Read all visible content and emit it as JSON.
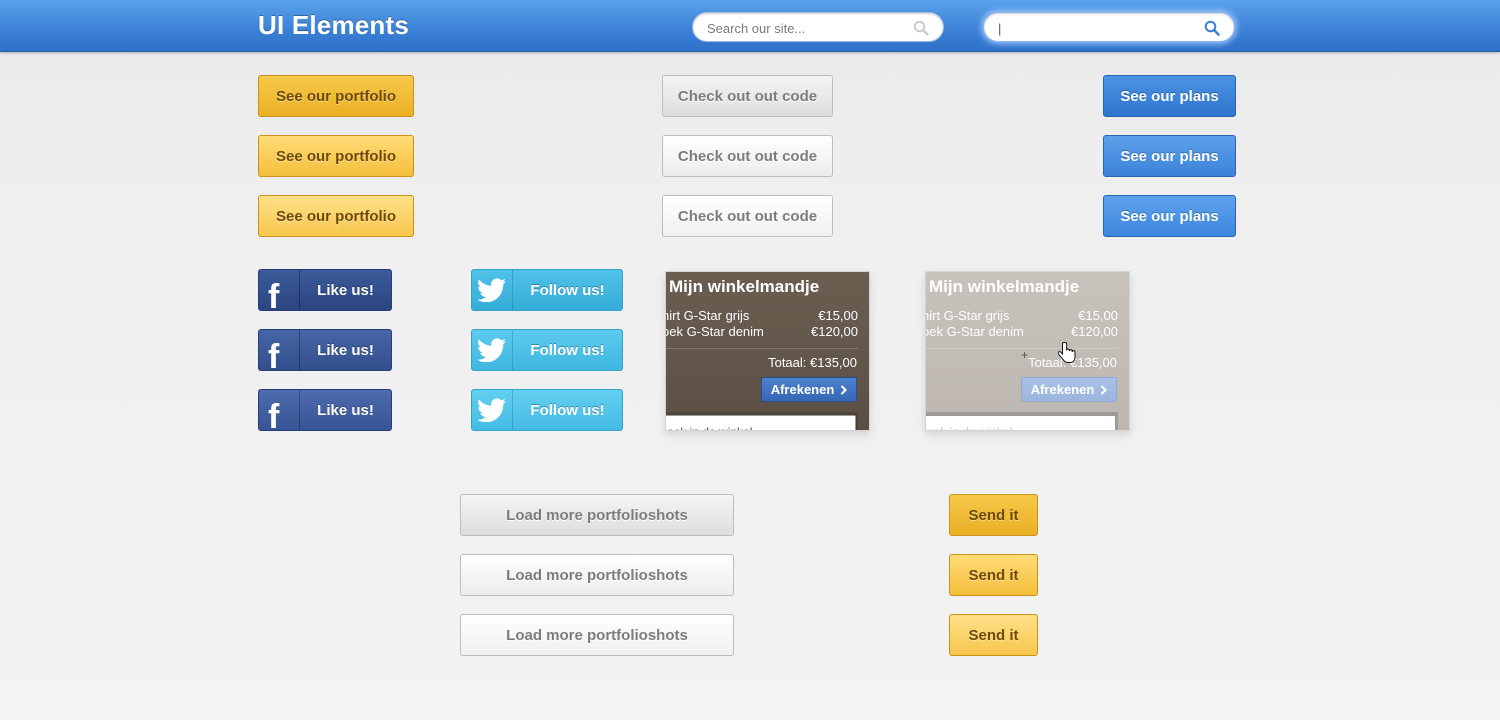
{
  "header": {
    "title": "UI Elements",
    "search1_placeholder": "Search our site...",
    "search2_value": "|"
  },
  "buttons": {
    "portfolio": "See our portfolio",
    "code": "Check out out code",
    "plans": "See our plans",
    "facebook": "Like us!",
    "facebook_glyph": "f",
    "twitter": "Follow us!",
    "load_more": "Load more portfolioshots",
    "send": "Send it"
  },
  "cart": {
    "title": "Mijn winkelmandje",
    "items": [
      {
        "name": "hirt G-Star grijs",
        "price": "€15,00"
      },
      {
        "name": "oek G-Star denim",
        "price": "€120,00"
      }
    ],
    "total": "Totaal: €135,00",
    "checkout": "Afrekenen",
    "checkout_icon": "chevron-right-icon",
    "search_text": "oek in de winkel..."
  },
  "colors": {
    "header_blue": "#3b80d6",
    "yellow": "#ebb025",
    "blue": "#2f75d0",
    "facebook": "#2b4580",
    "twitter": "#35acd8",
    "cart_dark": "#5b4f44"
  }
}
